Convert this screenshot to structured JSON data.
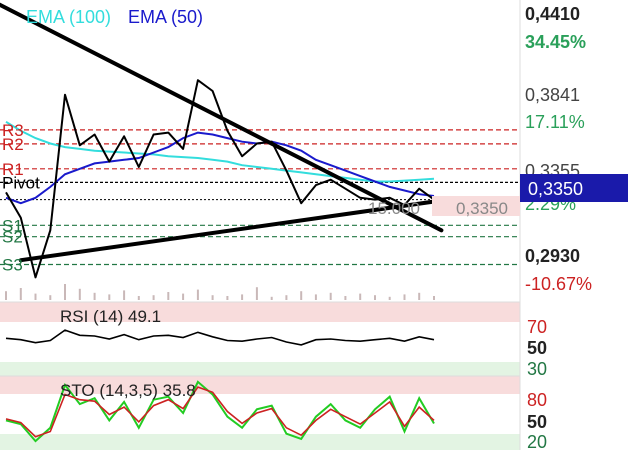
{
  "legend": {
    "ema100_label": "EMA (100)",
    "ema50_label": "EMA (50)"
  },
  "right_axis": {
    "price_ticks": [
      "0,4410",
      "0,3841",
      "0,3355",
      "0,2930"
    ],
    "pct_ticks": [
      "34.45%",
      "17.11%",
      "2.29%",
      "-10.67%"
    ],
    "current_price": "0,3350"
  },
  "pivot_labels": [
    "R3",
    "R2",
    "R1",
    "Pivot",
    "S1",
    "S2",
    "S3"
  ],
  "annotation": {
    "volume_text": "15.000",
    "box_text": "0,3350"
  },
  "rsi": {
    "label": "RSI (14) 49.1",
    "levels": [
      "70",
      "50",
      "30"
    ]
  },
  "sto": {
    "label": "STO (14,3,5) 35.8",
    "levels": [
      "80",
      "50",
      "20"
    ]
  },
  "colors": {
    "price": "#000000",
    "ema100": "#33dddd",
    "ema50": "#1a1acc",
    "resistance": "#cc2222",
    "support": "#227744",
    "pivot": "#000000",
    "pct_pos": "#2aa05a",
    "pct_neg": "#cc2222",
    "current_bg": "#1a1aaa",
    "sto_k": "#22cc22",
    "sto_d": "#cc2222",
    "zone_red": "#f8dcdc",
    "zone_green": "#e3f4e3"
  },
  "chart_data": [
    {
      "type": "line",
      "title": "",
      "ylim": [
        0.2795,
        0.442
      ],
      "series": [
        {
          "name": "EMA (100)",
          "values": [
            0.378,
            0.373,
            0.369,
            0.366,
            0.364,
            0.363,
            0.362,
            0.3615,
            0.361,
            0.3605,
            0.36,
            0.359,
            0.3585,
            0.358,
            0.357,
            0.356,
            0.354,
            0.353,
            0.352,
            0.351,
            0.35,
            0.349,
            0.348,
            0.347,
            0.346,
            0.345,
            0.345,
            0.3455,
            0.346,
            0.3465
          ]
        },
        {
          "name": "EMA (50)",
          "values": [
            0.336,
            0.333,
            0.336,
            0.342,
            0.349,
            0.352,
            0.355,
            0.356,
            0.357,
            0.358,
            0.361,
            0.364,
            0.369,
            0.372,
            0.371,
            0.369,
            0.367,
            0.366,
            0.367,
            0.365,
            0.362,
            0.357,
            0.354,
            0.351,
            0.348,
            0.345,
            0.342,
            0.34,
            0.338,
            0.337
          ]
        },
        {
          "name": "",
          "values": [
            0.339,
            0.325,
            0.292,
            0.318,
            0.393,
            0.365,
            0.371,
            0.356,
            0.37,
            0.353,
            0.371,
            0.372,
            0.363,
            0.401,
            0.395,
            0.373,
            0.359,
            0.366,
            0.367,
            0.351,
            0.333,
            0.343,
            0.346,
            0.341,
            0.336,
            0.335,
            0.336,
            0.332,
            0.341,
            0.335
          ]
        }
      ],
      "pivot_levels": {
        "R3": 0.3735,
        "R2": 0.3658,
        "R1": 0.352,
        "Pivot": 0.3445,
        "S1": 0.3208,
        "S2": 0.3145,
        "S3": 0.2991
      },
      "trendlines": [
        {
          "from": [
            -0.5,
            0.443
          ],
          "to": [
            29.5,
            0.318
          ]
        },
        {
          "from": [
            1,
            0.3015
          ],
          "to": [
            29.5,
            0.3345
          ]
        }
      ]
    },
    {
      "type": "bar",
      "title": "",
      "values": [
        1.1,
        1.5,
        0.8,
        0.6,
        2.0,
        1.4,
        0.9,
        0.7,
        1.2,
        0.5,
        0.6,
        1.0,
        0.8,
        1.3,
        0.6,
        0.5,
        0.7,
        1.6,
        0.4,
        0.6,
        1.1,
        0.7,
        0.9,
        0.5,
        0.8,
        0.6,
        0.4,
        0.7,
        0.9,
        0.5
      ]
    },
    {
      "type": "line",
      "title": "",
      "ylim": [
        0,
        100
      ],
      "series": [
        {
          "name": "RSI (14)",
          "values": [
            51,
            49,
            45,
            48,
            62,
            55,
            54,
            50,
            56,
            49,
            54,
            55,
            52,
            59,
            53,
            48,
            47,
            50,
            52,
            46,
            42,
            49,
            50,
            48,
            47,
            49,
            51,
            47,
            53,
            49.1
          ]
        }
      ]
    },
    {
      "type": "line",
      "title": "",
      "ylim": [
        0,
        100
      ],
      "series": [
        {
          "name": "",
          "values": [
            40,
            35,
            12,
            30,
            88,
            62,
            70,
            40,
            65,
            30,
            68,
            72,
            50,
            92,
            75,
            45,
            30,
            55,
            60,
            22,
            15,
            45,
            62,
            40,
            30,
            55,
            72,
            25,
            70,
            35.8
          ]
        },
        {
          "name": "",
          "values": [
            42,
            37,
            18,
            25,
            75,
            68,
            66,
            48,
            58,
            38,
            60,
            68,
            56,
            85,
            78,
            52,
            36,
            50,
            56,
            30,
            20,
            40,
            55,
            45,
            35,
            50,
            65,
            32,
            58,
            40
          ]
        }
      ]
    }
  ]
}
